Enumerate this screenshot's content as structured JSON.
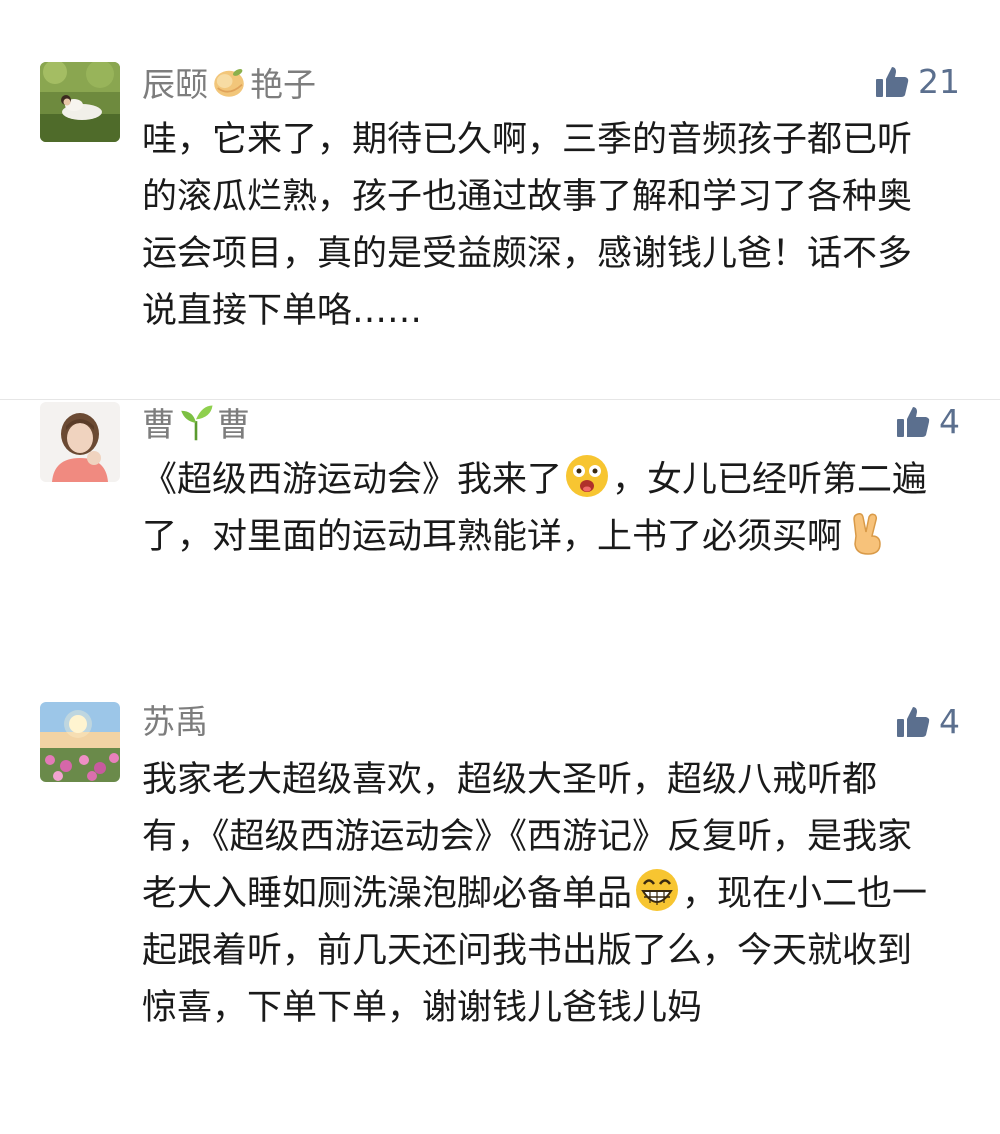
{
  "comments": [
    {
      "nickname_part1": "辰颐",
      "nickname_emoji": "peach-emoji",
      "nickname_part2": "艳子",
      "likes": "21",
      "text": "哇，它来了，期待已久啊，三季的音频孩子都已听的滚瓜烂熟，孩子也通过故事了解和学习了各种奥运会项目，真的是受益颇深，感谢钱儿爸！话不多说直接下单咯……",
      "avatar": "woman-in-garden-avatar"
    },
    {
      "nickname_part1": "曹",
      "nickname_emoji": "seedling-emoji",
      "nickname_part2": "曹",
      "likes": "4",
      "text_part1": "《超级西游运动会》我来了",
      "text_emoji1": "surprised-face-emoji",
      "text_part2": "，女儿已经听第二遍了，对里面的运动耳熟能详，上书了必须买啊",
      "text_emoji2": "victory-hand-emoji",
      "avatar": "girl-portrait-avatar"
    },
    {
      "nickname": "苏禹",
      "likes": "4",
      "text_part1": "我家老大超级喜欢，超级大圣听，超级八戒听都有，《超级西游运动会》《西游记》反复听，是我家老大入睡如厕洗澡泡脚必备单品",
      "text_emoji": "grinning-face-emoji",
      "text_part2": "，现在小二也一起跟着听，前几天还问我书出版了么，今天就收到惊喜，下单下单，谢谢钱儿爸钱儿妈",
      "avatar": "sunset-flowers-avatar"
    }
  ],
  "icons": {
    "like": "thumbs-up-icon"
  },
  "colors": {
    "nickname": "#7d7d7d",
    "like": "#5b6f8e",
    "text": "#1a1a1a",
    "divider": "#e6e6e6"
  }
}
